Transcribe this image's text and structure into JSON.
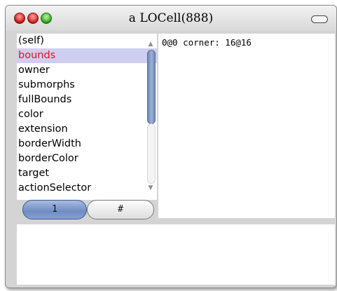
{
  "window": {
    "title": "a LOCell(888)"
  },
  "inspector": {
    "fields": [
      {
        "label": "(self)",
        "selected": false
      },
      {
        "label": "bounds",
        "selected": true
      },
      {
        "label": "owner",
        "selected": false
      },
      {
        "label": "submorphs",
        "selected": false
      },
      {
        "label": "fullBounds",
        "selected": false
      },
      {
        "label": "color",
        "selected": false
      },
      {
        "label": "extension",
        "selected": false
      },
      {
        "label": "borderWidth",
        "selected": false
      },
      {
        "label": "borderColor",
        "selected": false
      },
      {
        "label": "target",
        "selected": false
      },
      {
        "label": "actionSelector",
        "selected": false
      }
    ],
    "value": "0@0 corner: 16@16",
    "tabs": [
      {
        "label": "1",
        "active": true
      },
      {
        "label": "#",
        "active": false
      }
    ],
    "evaluator": ""
  },
  "colors": {
    "selection_bg": "#cecff0",
    "selection_text": "#e8101c",
    "active_tab": "#7b96cc"
  }
}
